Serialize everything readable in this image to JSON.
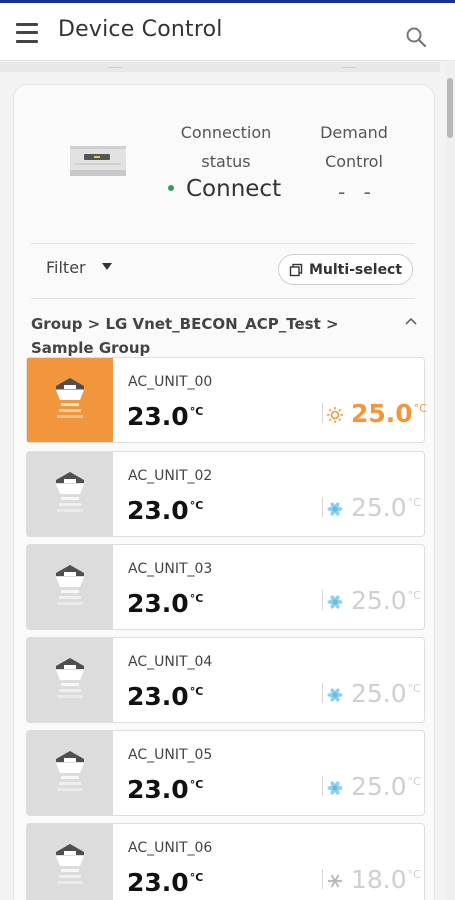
{
  "app_bar": {
    "title": "Device Control",
    "menu_icon": "hamburger-menu-icon",
    "search_icon": "search-icon"
  },
  "status": {
    "connection_label": "Connection status",
    "connection_value": "Connect",
    "connection_color": "#2e9d63",
    "demand_label": "Demand Control",
    "demand_value": "- -"
  },
  "toolbar": {
    "filter_label": "Filter",
    "multi_select_label": "Multi-select"
  },
  "breadcrumb": "Group > LG Vnet_BECON_ACP_Test > Sample Group",
  "units_temp_unit": "°C",
  "units": [
    {
      "name": "AC_UNIT_00",
      "current": "23.0",
      "set": "25.0",
      "mode": "heat",
      "active": true
    },
    {
      "name": "AC_UNIT_02",
      "current": "23.0",
      "set": "25.0",
      "mode": "cool",
      "active": false
    },
    {
      "name": "AC_UNIT_03",
      "current": "23.0",
      "set": "25.0",
      "mode": "cool",
      "active": false
    },
    {
      "name": "AC_UNIT_04",
      "current": "23.0",
      "set": "25.0",
      "mode": "cool",
      "active": false
    },
    {
      "name": "AC_UNIT_05",
      "current": "23.0",
      "set": "25.0",
      "mode": "cool",
      "active": false
    },
    {
      "name": "AC_UNIT_06",
      "current": "23.0",
      "set": "18.0",
      "mode": "snow",
      "active": false
    }
  ],
  "colors": {
    "accent_orange": "#f1963c",
    "cool_blue": "#8fd0ef",
    "header_accent": "#1a2f8f"
  }
}
